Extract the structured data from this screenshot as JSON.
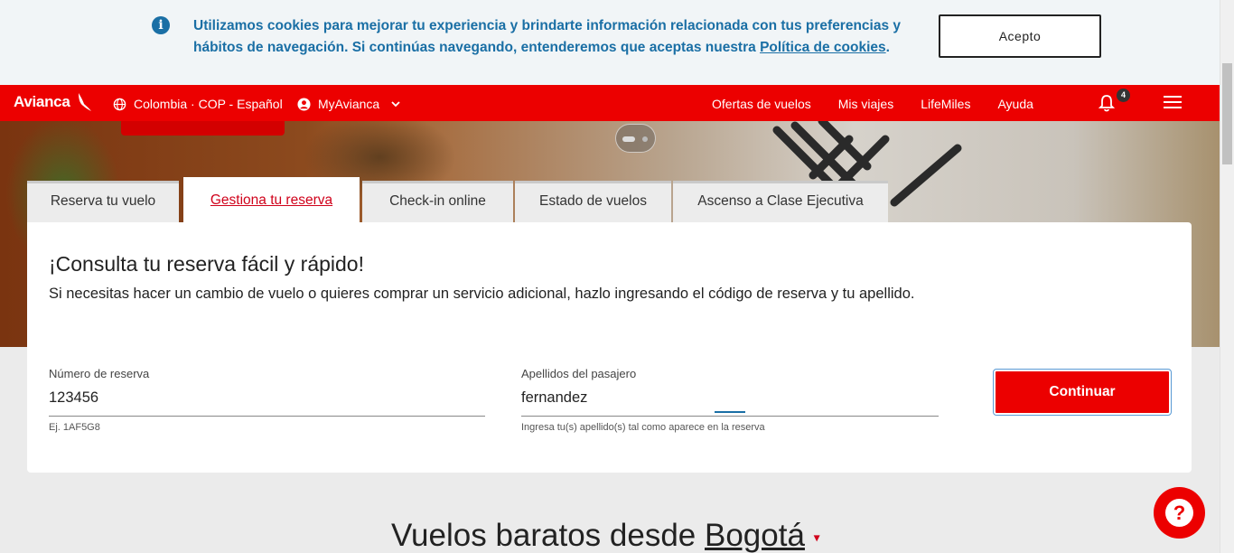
{
  "cookie_banner": {
    "message": "Utilizamos cookies para mejorar tu experiencia y brindarte información relacionada con tus preferencias y hábitos de navegación. Si continúas navegando, entenderemos que aceptas nuestra ",
    "link_text": "Política de cookies",
    "message_end": ".",
    "accept_label": "Acepto"
  },
  "nav": {
    "logo": "Avianca",
    "country": "Colombia · COP - Español",
    "account": "MyAvianca",
    "links": [
      "Ofertas de vuelos",
      "Mis viajes",
      "LifeMiles",
      "Ayuda"
    ],
    "notifications_count": "4"
  },
  "tabs": [
    "Reserva tu vuelo",
    "Gestiona tu reserva",
    "Check-in online",
    "Estado de vuelos",
    "Ascenso a Clase Ejecutiva"
  ],
  "active_tab_index": 1,
  "form": {
    "title": "¡Consulta tu reserva fácil y rápido!",
    "subtitle": "Si necesitas hacer un cambio de vuelo o quieres comprar un servicio adicional, hazlo ingresando el código de reserva y tu apellido.",
    "reservation": {
      "label": "Número de reserva",
      "value": "123456",
      "hint": "Ej. 1AF5G8"
    },
    "surname": {
      "label": "Apellidos del pasajero",
      "value": "fernandez",
      "hint": "Ingresa tu(s) apellido(s) tal como aparece en la reserva"
    },
    "submit_label": "Continuar"
  },
  "bottom": {
    "title_prefix": "Vuelos baratos desde ",
    "city": "Bogotá"
  },
  "colors": {
    "brand_red": "#ec0000",
    "info_blue": "#1a6fa5"
  },
  "icons": [
    "info-icon",
    "avianca-bird-icon",
    "globe-icon",
    "user-icon",
    "chevron-down-icon",
    "bell-icon",
    "hamburger-menu-icon",
    "help-icon"
  ]
}
